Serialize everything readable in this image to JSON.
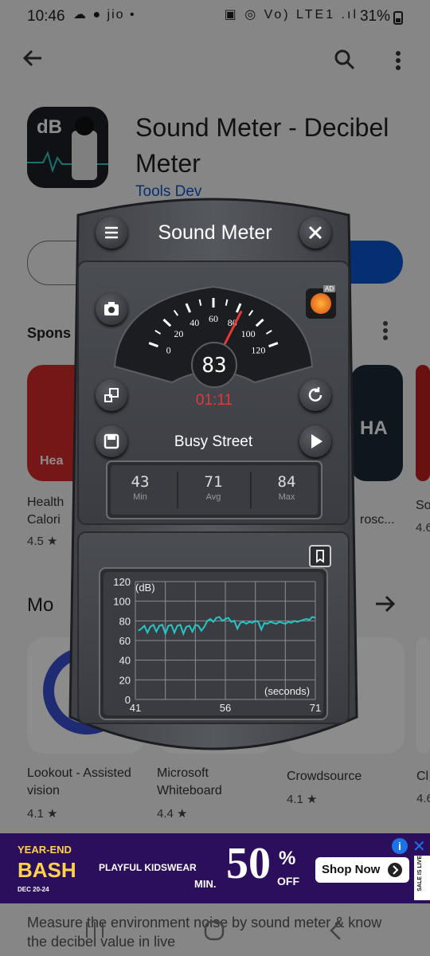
{
  "status": {
    "time": "10:46",
    "battery": "31%",
    "left_icons": "☁ ● jio •",
    "right_icons": "▣ ◎ Vo) LTE1 .ıl"
  },
  "store": {
    "app_title": "Sound Meter - Decibel Meter",
    "app_icon_text": "dB",
    "developer": "Tools Dev",
    "sponsored": "Spons",
    "sponsored_cards": [
      {
        "name": "Health",
        "name2": "Calori",
        "rating": "4.5 ★",
        "badge": "Hea"
      },
      {
        "name": "",
        "name2": "rosc...",
        "rating": "",
        "badge": "HA"
      },
      {
        "name": "So",
        "name2": "",
        "rating": "4.6",
        "badge": ""
      }
    ],
    "more_heading": "Mo",
    "more_apps": [
      {
        "name": "Lookout - Assisted vision",
        "rating": "4.1 ★"
      },
      {
        "name": "Microsoft Whiteboard",
        "rating": "4.4 ★"
      },
      {
        "name": "Crowdsource",
        "rating": "4.1 ★"
      },
      {
        "name": "Cl",
        "rating": "4.6"
      }
    ],
    "description": "Measure the environment noise by sound meter & know the decibel value in live"
  },
  "ad": {
    "brand_line1": "YEAR-END",
    "brand_line2": "BASH",
    "date": "DEC 20-24",
    "tagline": "PLAYFUL KIDSWEAR",
    "min": "MIN.",
    "percent": "50",
    "pct_sign": "%",
    "off": "OFF",
    "cta": "Shop Now",
    "side": "SALE IS LIVE"
  },
  "meter": {
    "title": "Sound Meter",
    "dial_ticks": [
      "0",
      "20",
      "40",
      "60",
      "80",
      "100",
      "120"
    ],
    "needle_value": 83,
    "reading": "83",
    "timer": "01:11",
    "preset": "Busy Street",
    "ad_badge": "AD",
    "stats": [
      {
        "value": "43",
        "label": "Min"
      },
      {
        "value": "71",
        "label": "Avg"
      },
      {
        "value": "84",
        "label": "Max"
      }
    ]
  },
  "chart_data": {
    "type": "line",
    "title": "",
    "xlabel": "(seconds)",
    "ylabel": "(dB)",
    "ylim": [
      0,
      120
    ],
    "xlim": [
      41,
      71
    ],
    "y_ticks": [
      "0",
      "20",
      "40",
      "60",
      "80",
      "100",
      "120"
    ],
    "x_ticks": [
      "41",
      "56",
      "71"
    ],
    "grid": true,
    "series": [
      {
        "values": [
          [
            41.5,
            70
          ],
          [
            42,
            72
          ],
          [
            42.5,
            75
          ],
          [
            43,
            68
          ],
          [
            43.5,
            74
          ],
          [
            44,
            76
          ],
          [
            44.5,
            69
          ],
          [
            45,
            75
          ],
          [
            45.5,
            76
          ],
          [
            46,
            67
          ],
          [
            46.5,
            75
          ],
          [
            47,
            76
          ],
          [
            47.5,
            68
          ],
          [
            48,
            75
          ],
          [
            48.5,
            76
          ],
          [
            49,
            67
          ],
          [
            49.5,
            74
          ],
          [
            50,
            75
          ],
          [
            50.5,
            69
          ],
          [
            51,
            76
          ],
          [
            51.5,
            75
          ],
          [
            52,
            70
          ],
          [
            52.5,
            74
          ],
          [
            53,
            80
          ],
          [
            53.5,
            82
          ],
          [
            54,
            79
          ],
          [
            54.5,
            83
          ],
          [
            55,
            84
          ],
          [
            55.5,
            80
          ],
          [
            56,
            82
          ],
          [
            56.5,
            83
          ],
          [
            57,
            79
          ],
          [
            57.5,
            80
          ],
          [
            58,
            72
          ],
          [
            58.5,
            78
          ],
          [
            59,
            79
          ],
          [
            59.5,
            77
          ],
          [
            60,
            79
          ],
          [
            60.5,
            78
          ],
          [
            61,
            80
          ],
          [
            61.5,
            79
          ],
          [
            62,
            71
          ],
          [
            62.5,
            78
          ],
          [
            63,
            77
          ],
          [
            63.5,
            79
          ],
          [
            64,
            78
          ],
          [
            64.5,
            77
          ],
          [
            65,
            79
          ],
          [
            65.5,
            78
          ],
          [
            66,
            77
          ],
          [
            66.5,
            79
          ],
          [
            67,
            78
          ],
          [
            67.5,
            80
          ],
          [
            68,
            79
          ],
          [
            68.5,
            80
          ],
          [
            69,
            81
          ],
          [
            69.5,
            82
          ],
          [
            70,
            81
          ],
          [
            70.5,
            84
          ],
          [
            71,
            83
          ]
        ]
      }
    ]
  }
}
